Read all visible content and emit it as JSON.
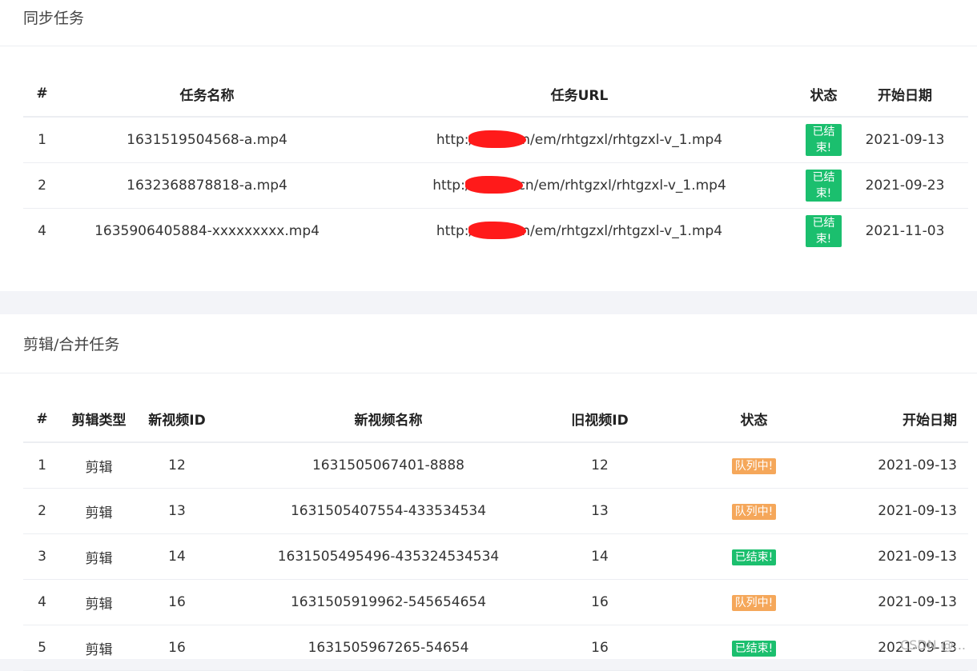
{
  "sync": {
    "title": "同步任务",
    "headers": [
      "#",
      "任务名称",
      "任务URL",
      "状态",
      "开始日期"
    ],
    "rows": [
      {
        "no": "1",
        "name": "1631519504568-a.mp4",
        "url_prefix": "http:/",
        "url_suffix": "n/em/rhtgzxl/rhtgzxl-v_1.mp4",
        "status": "已结束!",
        "date": "2021-09-13"
      },
      {
        "no": "2",
        "name": "1632368878818-a.mp4",
        "url_prefix": "http:/",
        "url_suffix": "cn/em/rhtgzxl/rhtgzxl-v_1.mp4",
        "status": "已结束!",
        "date": "2021-09-23"
      },
      {
        "no": "4",
        "name": "1635906405884-xxxxxxxxx.mp4",
        "url_prefix": "http:/",
        "url_suffix": "n/em/rhtgzxl/rhtgzxl-v_1.mp4",
        "status": "已结束!",
        "date": "2021-11-03"
      }
    ]
  },
  "edit": {
    "title": "剪辑/合并任务",
    "headers": [
      "#",
      "剪辑类型",
      "新视频ID",
      "新视频名称",
      "旧视频ID",
      "状态",
      "开始日期"
    ],
    "rows": [
      {
        "no": "1",
        "type": "剪辑",
        "new_id": "12",
        "new_name": "1631505067401-8888",
        "old_id": "12",
        "status": "队列中!",
        "status_kind": "queue",
        "date": "2021-09-13"
      },
      {
        "no": "2",
        "type": "剪辑",
        "new_id": "13",
        "new_name": "1631505407554-433534534",
        "old_id": "13",
        "status": "队列中!",
        "status_kind": "queue",
        "date": "2021-09-13"
      },
      {
        "no": "3",
        "type": "剪辑",
        "new_id": "14",
        "new_name": "1631505495496-435324534534",
        "old_id": "14",
        "status": "已结束!",
        "status_kind": "done",
        "date": "2021-09-13"
      },
      {
        "no": "4",
        "type": "剪辑",
        "new_id": "16",
        "new_name": "1631505919962-545654654",
        "old_id": "16",
        "status": "队列中!",
        "status_kind": "queue",
        "date": "2021-09-13"
      },
      {
        "no": "5",
        "type": "剪辑",
        "new_id": "16",
        "new_name": "1631505967265-54654",
        "old_id": "16",
        "status": "已结束!",
        "status_kind": "done",
        "date": "2021-09-13"
      }
    ]
  },
  "watermark": "CSDN @..."
}
